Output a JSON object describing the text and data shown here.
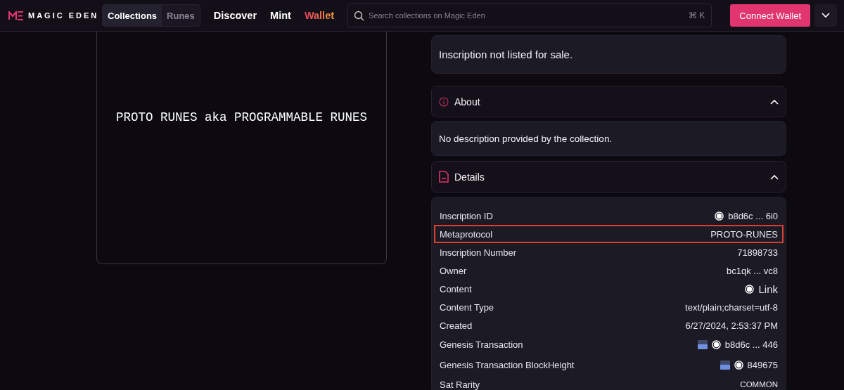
{
  "header": {
    "brand": "MAGIC EDEN",
    "toggle": [
      {
        "label": "Collections",
        "selected": true
      },
      {
        "label": "Runes",
        "selected": false
      }
    ],
    "nav": [
      {
        "label": "Discover",
        "selected": false
      },
      {
        "label": "Mint",
        "selected": false
      },
      {
        "label": "Wallet",
        "selected": true
      }
    ],
    "search": {
      "placeholder": "Search collections on Magic Eden",
      "shortcut": "⌘ K"
    },
    "connect_button": "Connect Wallet"
  },
  "preview": {
    "text": "PROTO RUNES aka PROGRAMMABLE RUNES"
  },
  "listing": {
    "text": "Inscription not listed for sale."
  },
  "about": {
    "title": "About",
    "expanded": true,
    "text": "No description provided by the collection."
  },
  "details": {
    "title": "Details",
    "expanded": true,
    "rows": [
      {
        "label": "Inscription ID",
        "value": "b8d6c ... 6i0",
        "kind": "ordinal",
        "highlighted": false
      },
      {
        "label": "Metaprotocol",
        "value": "PROTO-RUNES",
        "kind": "plain",
        "highlighted": true
      },
      {
        "label": "Inscription Number",
        "value": "71898733",
        "kind": "plain",
        "highlighted": false
      },
      {
        "label": "Owner",
        "value": "bc1qk ... vc8",
        "kind": "plain",
        "highlighted": false
      },
      {
        "label": "Content",
        "value": "Link",
        "kind": "ordinal-large",
        "highlighted": false
      },
      {
        "label": "Content Type",
        "value": "text/plain;charset=utf-8",
        "kind": "plain",
        "highlighted": false
      },
      {
        "label": "Created",
        "value": "6/27/2024, 2:53:37 PM",
        "kind": "plain",
        "highlighted": false
      },
      {
        "label": "Genesis Transaction",
        "value": "b8d6c ... 446",
        "kind": "block-ordinal",
        "highlighted": false
      },
      {
        "label": "Genesis Transaction BlockHeight",
        "value": "849675",
        "kind": "block-ordinal",
        "highlighted": false
      },
      {
        "label": "Sat Rarity",
        "value": "COMMON",
        "kind": "small",
        "highlighted": false
      }
    ]
  }
}
